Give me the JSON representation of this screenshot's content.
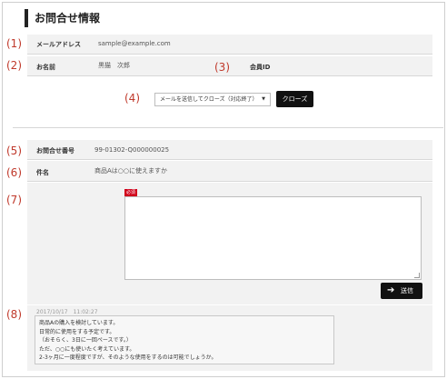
{
  "page": {
    "title": "お問合せ情報"
  },
  "markers": [
    "(1)",
    "(2)",
    "(3)",
    "(4)",
    "(5)",
    "(6)",
    "(7)",
    "(8)"
  ],
  "customer": {
    "email_label": "メールアドレス",
    "email_value": "sample@example.com",
    "name_label": "お名前",
    "name_value": "黒猫　次郎",
    "member_label": "会員ID",
    "member_value": ""
  },
  "actions": {
    "status_selected": "メールを送信してクローズ（対応終了）",
    "close_label": "クローズ"
  },
  "inquiry": {
    "number_label": "お問合せ番号",
    "number_value": "99-01302-Q000000025",
    "subject_label": "件名",
    "subject_value": "商品Aは○○に使えますか"
  },
  "reply": {
    "required_badge": "必須",
    "body_value": "",
    "send_label": "送信"
  },
  "history": {
    "timestamp": "2017/10/17　11:02:27",
    "lines": [
      "商品Aの購入を検討しています。",
      "日常的に使用をする予定です。",
      "（おそらく、3日に一回ペースです。）",
      "ただ、○○にも使いたく考えています。",
      "2-3ヶ月に一度程度ですが、そのような使用をするのは可能でしょうか。"
    ]
  }
}
